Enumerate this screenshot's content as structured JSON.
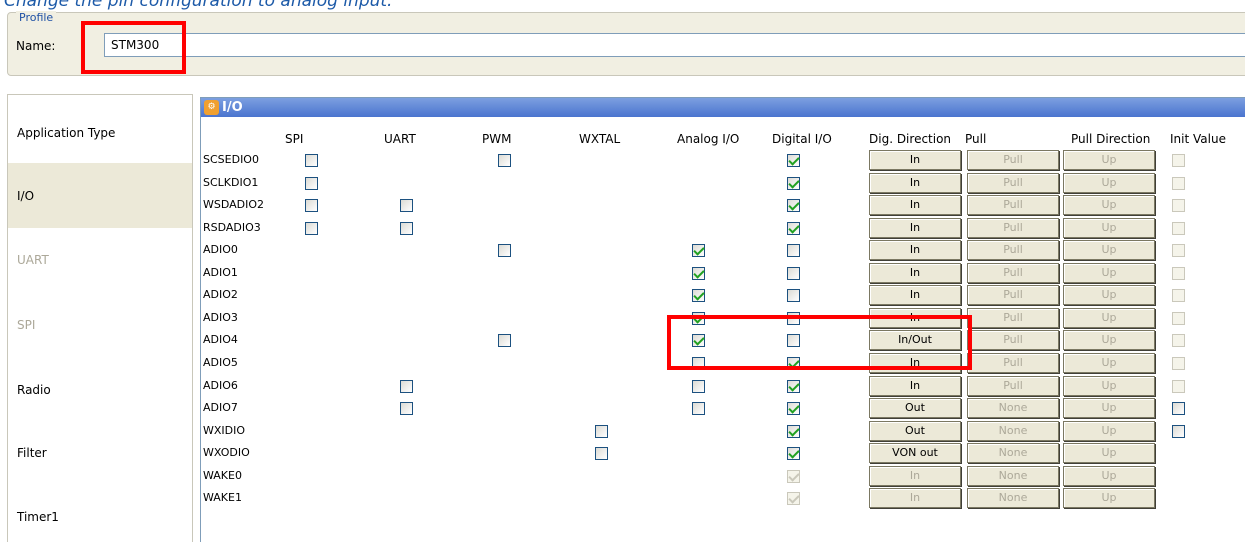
{
  "caption": "Change the pin configuration to analog input.",
  "profile": {
    "legend": "Profile",
    "name_label": "Name:",
    "name_value": "STM300"
  },
  "nav": [
    {
      "label": "Application Type",
      "state": "normal"
    },
    {
      "label": "I/O",
      "state": "selected"
    },
    {
      "label": "UART",
      "state": "disabled"
    },
    {
      "label": "SPI",
      "state": "disabled"
    },
    {
      "label": "Radio",
      "state": "normal"
    },
    {
      "label": "Filter",
      "state": "normal"
    },
    {
      "label": "Timer1",
      "state": "normal"
    }
  ],
  "panel": {
    "title": "I/O",
    "icon": "settings-icon",
    "header_color": "#5a80d8"
  },
  "columns": [
    "SPI",
    "UART",
    "PWM",
    "WXTAL",
    "Analog I/O",
    "Digital I/O",
    "Dig. Direction",
    "Pull",
    "Pull Direction",
    "Init Value"
  ],
  "rows": [
    {
      "pin": "SCSEDIO0",
      "spi": false,
      "uart": null,
      "pwm": false,
      "wxtal": null,
      "analog": null,
      "digital": true,
      "digital_disabled": false,
      "direction": "In",
      "direction_disabled": false,
      "pull": "Pull",
      "pull_direction": "Up",
      "init": false,
      "init_disabled": true
    },
    {
      "pin": "SCLKDIO1",
      "spi": false,
      "uart": null,
      "pwm": null,
      "wxtal": null,
      "analog": null,
      "digital": true,
      "digital_disabled": false,
      "direction": "In",
      "direction_disabled": false,
      "pull": "Pull",
      "pull_direction": "Up",
      "init": false,
      "init_disabled": true
    },
    {
      "pin": "WSDADIO2",
      "spi": false,
      "uart": false,
      "pwm": null,
      "wxtal": null,
      "analog": null,
      "digital": true,
      "digital_disabled": false,
      "direction": "In",
      "direction_disabled": false,
      "pull": "Pull",
      "pull_direction": "Up",
      "init": false,
      "init_disabled": true
    },
    {
      "pin": "RSDADIO3",
      "spi": false,
      "uart": false,
      "pwm": null,
      "wxtal": null,
      "analog": null,
      "digital": true,
      "digital_disabled": false,
      "direction": "In",
      "direction_disabled": false,
      "pull": "Pull",
      "pull_direction": "Up",
      "init": false,
      "init_disabled": true
    },
    {
      "pin": "ADIO0",
      "spi": null,
      "uart": null,
      "pwm": false,
      "wxtal": null,
      "analog": true,
      "digital": false,
      "digital_disabled": false,
      "direction": "In",
      "direction_disabled": false,
      "pull": "Pull",
      "pull_direction": "Up",
      "init": false,
      "init_disabled": true
    },
    {
      "pin": "ADIO1",
      "spi": null,
      "uart": null,
      "pwm": null,
      "wxtal": null,
      "analog": true,
      "digital": false,
      "digital_disabled": false,
      "direction": "In",
      "direction_disabled": false,
      "pull": "Pull",
      "pull_direction": "Up",
      "init": false,
      "init_disabled": true
    },
    {
      "pin": "ADIO2",
      "spi": null,
      "uart": null,
      "pwm": null,
      "wxtal": null,
      "analog": true,
      "digital": false,
      "digital_disabled": false,
      "direction": "In",
      "direction_disabled": false,
      "pull": "Pull",
      "pull_direction": "Up",
      "init": false,
      "init_disabled": true
    },
    {
      "pin": "ADIO3",
      "spi": null,
      "uart": null,
      "pwm": null,
      "wxtal": null,
      "analog": true,
      "digital": false,
      "digital_disabled": false,
      "direction": "In",
      "direction_disabled": false,
      "pull": "Pull",
      "pull_direction": "Up",
      "init": false,
      "init_disabled": true
    },
    {
      "pin": "ADIO4",
      "spi": null,
      "uart": null,
      "pwm": false,
      "wxtal": null,
      "analog": true,
      "digital": false,
      "digital_disabled": false,
      "direction": "In/Out",
      "direction_disabled": false,
      "pull": "Pull",
      "pull_direction": "Up",
      "init": false,
      "init_disabled": true
    },
    {
      "pin": "ADIO5",
      "spi": null,
      "uart": null,
      "pwm": null,
      "wxtal": null,
      "analog": false,
      "digital": true,
      "digital_disabled": false,
      "direction": "In",
      "direction_disabled": false,
      "pull": "Pull",
      "pull_direction": "Up",
      "init": false,
      "init_disabled": true
    },
    {
      "pin": "ADIO6",
      "spi": null,
      "uart": false,
      "pwm": null,
      "wxtal": null,
      "analog": false,
      "digital": true,
      "digital_disabled": false,
      "direction": "In",
      "direction_disabled": false,
      "pull": "Pull",
      "pull_direction": "Up",
      "init": false,
      "init_disabled": true
    },
    {
      "pin": "ADIO7",
      "spi": null,
      "uart": false,
      "pwm": null,
      "wxtal": null,
      "analog": false,
      "digital": true,
      "digital_disabled": false,
      "direction": "Out",
      "direction_disabled": false,
      "pull": "None",
      "pull_direction": "Up",
      "init": false,
      "init_disabled": false
    },
    {
      "pin": "WXIDIO",
      "spi": null,
      "uart": null,
      "pwm": null,
      "wxtal": false,
      "analog": null,
      "digital": true,
      "digital_disabled": false,
      "direction": "Out",
      "direction_disabled": false,
      "pull": "None",
      "pull_direction": "Up",
      "init": false,
      "init_disabled": false
    },
    {
      "pin": "WXODIO",
      "spi": null,
      "uart": null,
      "pwm": null,
      "wxtal": false,
      "analog": null,
      "digital": true,
      "digital_disabled": false,
      "direction": "VON out",
      "direction_disabled": false,
      "pull": "None",
      "pull_direction": "Up",
      "init": null,
      "init_disabled": false
    },
    {
      "pin": "WAKE0",
      "spi": null,
      "uart": null,
      "pwm": null,
      "wxtal": null,
      "analog": null,
      "digital": true,
      "digital_disabled": true,
      "direction": "In",
      "direction_disabled": true,
      "pull": "None",
      "pull_direction": "Up",
      "init": null,
      "init_disabled": false
    },
    {
      "pin": "WAKE1",
      "spi": null,
      "uart": null,
      "pwm": null,
      "wxtal": null,
      "analog": null,
      "digital": true,
      "digital_disabled": true,
      "direction": "In",
      "direction_disabled": true,
      "pull": "None",
      "pull_direction": "Up",
      "init": null,
      "init_disabled": false
    }
  ],
  "highlight_color": "#ff0000"
}
